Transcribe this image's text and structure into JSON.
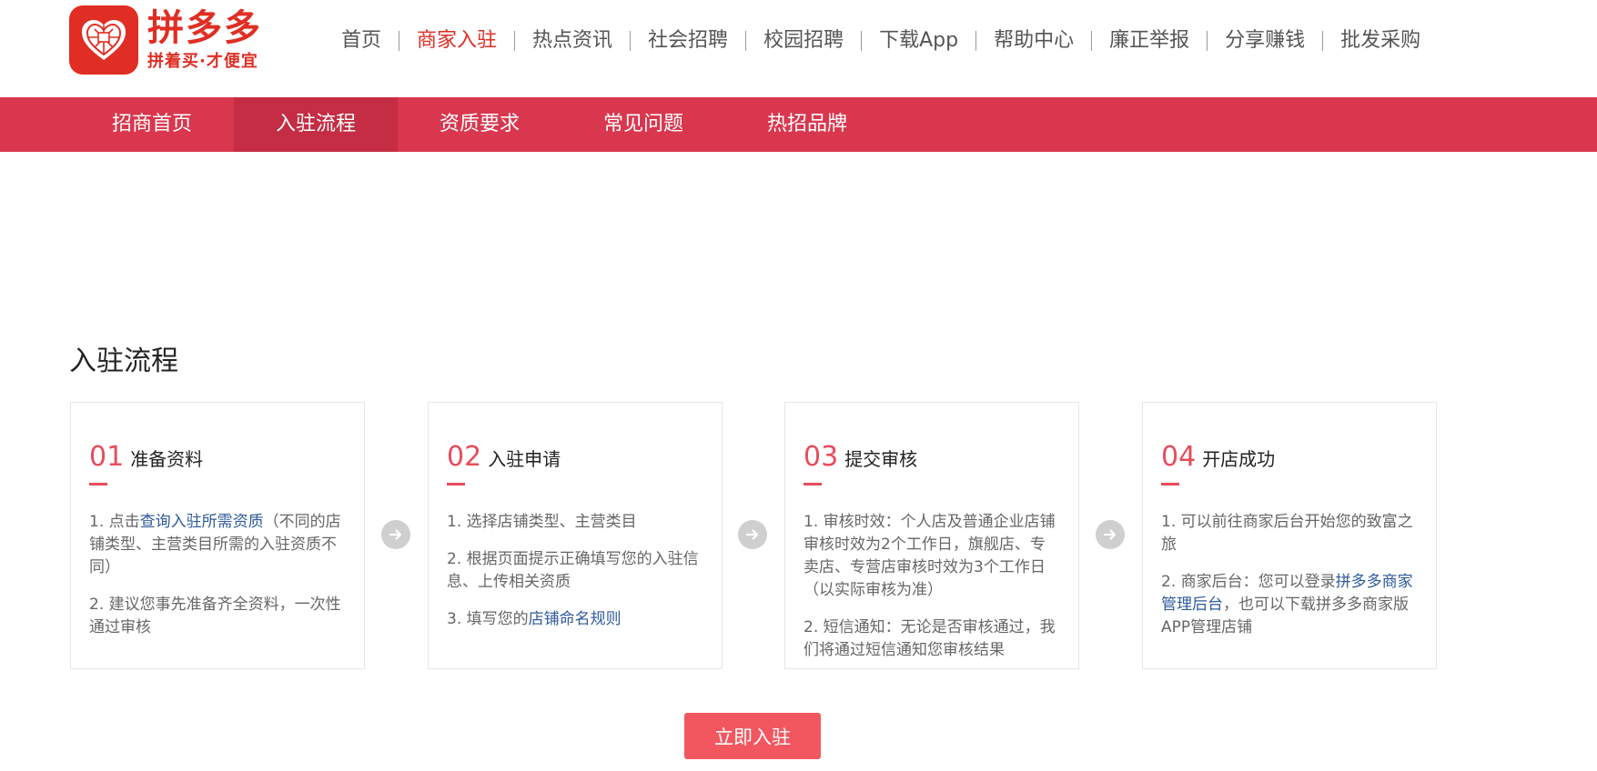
{
  "header": {
    "logo": {
      "name": "拼多多",
      "slogan": "拼着买·才便宜",
      "icon": "pdd-logo-icon",
      "brand_color": "#e02e24"
    },
    "nav": [
      {
        "label": "首页",
        "active": false
      },
      {
        "label": "商家入驻",
        "active": true
      },
      {
        "label": "热点资讯",
        "active": false
      },
      {
        "label": "社会招聘",
        "active": false
      },
      {
        "label": "校园招聘",
        "active": false
      },
      {
        "label": "下载App",
        "active": false
      },
      {
        "label": "帮助中心",
        "active": false
      },
      {
        "label": "廉正举报",
        "active": false
      },
      {
        "label": "分享赚钱",
        "active": false
      },
      {
        "label": "批发采购",
        "active": false
      }
    ]
  },
  "subnav": {
    "color": "#d9374e",
    "items": [
      {
        "label": "招商首页",
        "active": false
      },
      {
        "label": "入驻流程",
        "active": true
      },
      {
        "label": "资质要求",
        "active": false
      },
      {
        "label": "常见问题",
        "active": false
      },
      {
        "label": "热招品牌",
        "active": false
      }
    ]
  },
  "section": {
    "title": "入驻流程",
    "accent_color": "#e84c5c",
    "link_color": "#2e5a9c",
    "steps": [
      {
        "num": "01",
        "name": "准备资料",
        "lines": [
          {
            "pre": "1. 点击",
            "link": "查询入驻所需资质",
            "post": "（不同的店铺类型、主营类目所需的入驻资质不同）"
          },
          {
            "pre": "2. 建议您事先准备齐全资料，一次性通过审核",
            "link": "",
            "post": ""
          }
        ]
      },
      {
        "num": "02",
        "name": "入驻申请",
        "lines": [
          {
            "pre": "1. 选择店铺类型、主营类目",
            "link": "",
            "post": ""
          },
          {
            "pre": "2. 根据页面提示正确填写您的入驻信息、上传相关资质",
            "link": "",
            "post": ""
          },
          {
            "pre": "3. 填写您的",
            "link": "店铺命名规则",
            "post": ""
          }
        ]
      },
      {
        "num": "03",
        "name": "提交审核",
        "lines": [
          {
            "pre": "1. 审核时效：个人店及普通企业店铺审核时效为2个工作日，旗舰店、专卖店、专营店审核时效为3个工作日（以实际审核为准）",
            "link": "",
            "post": ""
          },
          {
            "pre": "2. 短信通知：无论是否审核通过，我们将通过短信通知您审核结果",
            "link": "",
            "post": ""
          }
        ]
      },
      {
        "num": "04",
        "name": "开店成功",
        "lines": [
          {
            "pre": "1. 可以前往商家后台开始您的致富之旅",
            "link": "",
            "post": ""
          },
          {
            "pre": "2. 商家后台：您可以登录",
            "link": "拼多多商家管理后台",
            "post": "，也可以下载拼多多商家版APP管理店铺"
          }
        ]
      }
    ],
    "arrow_icon": "arrow-right-circle-icon",
    "cta_label": "立即入驻",
    "cta_color": "#f25760"
  }
}
